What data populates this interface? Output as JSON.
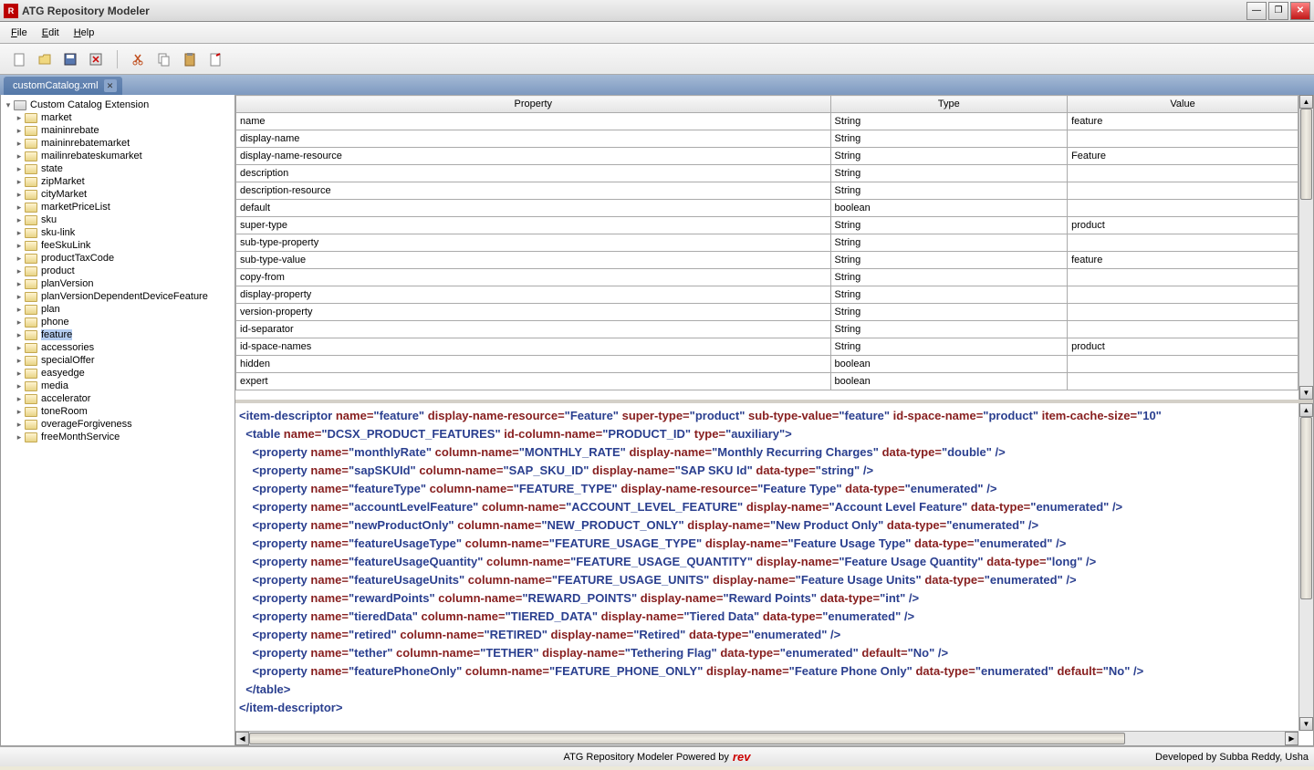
{
  "title": "ATG Repository Modeler",
  "menu": {
    "file": "File",
    "edit": "Edit",
    "help": "Help"
  },
  "tab": {
    "name": "customCatalog.xml"
  },
  "tree": {
    "root": "Custom Catalog Extension",
    "items": [
      "market",
      "maininrebate",
      "maininrebatemarket",
      "mailinrebateskumarket",
      "state",
      "zipMarket",
      "cityMarket",
      "marketPriceList",
      "sku",
      "sku-link",
      "feeSkuLink",
      "productTaxCode",
      "product",
      "planVersion",
      "planVersionDependentDeviceFeature",
      "plan",
      "phone",
      "feature",
      "accessories",
      "specialOffer",
      "easyedge",
      "media",
      "accelerator",
      "toneRoom",
      "overageForgiveness",
      "freeMonthService"
    ],
    "selected": "feature"
  },
  "table": {
    "headers": [
      "Property",
      "Type",
      "Value"
    ],
    "rows": [
      {
        "p": "name",
        "t": "String",
        "v": "feature"
      },
      {
        "p": "display-name",
        "t": "String",
        "v": ""
      },
      {
        "p": "display-name-resource",
        "t": "String",
        "v": "Feature"
      },
      {
        "p": "description",
        "t": "String",
        "v": ""
      },
      {
        "p": "description-resource",
        "t": "String",
        "v": ""
      },
      {
        "p": "default",
        "t": "boolean",
        "v": ""
      },
      {
        "p": "super-type",
        "t": "String",
        "v": "product"
      },
      {
        "p": "sub-type-property",
        "t": "String",
        "v": ""
      },
      {
        "p": "sub-type-value",
        "t": "String",
        "v": "feature"
      },
      {
        "p": "copy-from",
        "t": "String",
        "v": ""
      },
      {
        "p": "display-property",
        "t": "String",
        "v": ""
      },
      {
        "p": "version-property",
        "t": "String",
        "v": ""
      },
      {
        "p": "id-separator",
        "t": "String",
        "v": ""
      },
      {
        "p": "id-space-names",
        "t": "String",
        "v": "product"
      },
      {
        "p": "hidden",
        "t": "boolean",
        "v": ""
      },
      {
        "p": "expert",
        "t": "boolean",
        "v": ""
      }
    ]
  },
  "xml": {
    "itemDescriptor": {
      "name": "feature",
      "displayNameResource": "Feature",
      "superType": "product",
      "subTypeValue": "feature",
      "idSpaceName": "product",
      "itemCacheSize": "10"
    },
    "tableEl": {
      "name": "DCSX_PRODUCT_FEATURES",
      "idColumnName": "PRODUCT_ID",
      "type": "auxiliary"
    },
    "props": [
      {
        "name": "monthlyRate",
        "columnName": "MONTHLY_RATE",
        "displayName": "Monthly Recurring Charges",
        "dataType": "double"
      },
      {
        "name": "sapSKUId",
        "columnName": "SAP_SKU_ID",
        "displayName": "SAP SKU Id",
        "dataType": "string"
      },
      {
        "name": "featureType",
        "columnName": "FEATURE_TYPE",
        "displayNameResource": "Feature Type",
        "dataType": "enumerated"
      },
      {
        "name": "accountLevelFeature",
        "columnName": "ACCOUNT_LEVEL_FEATURE",
        "displayName": "Account Level Feature",
        "dataType": "enumerated"
      },
      {
        "name": "newProductOnly",
        "columnName": "NEW_PRODUCT_ONLY",
        "displayName": "New Product Only",
        "dataType": "enumerated"
      },
      {
        "name": "featureUsageType",
        "columnName": "FEATURE_USAGE_TYPE",
        "displayName": "Feature Usage Type",
        "dataType": "enumerated"
      },
      {
        "name": "featureUsageQuantity",
        "columnName": "FEATURE_USAGE_QUANTITY",
        "displayName": "Feature Usage Quantity",
        "dataType": "long"
      },
      {
        "name": "featureUsageUnits",
        "columnName": "FEATURE_USAGE_UNITS",
        "displayName": "Feature Usage Units",
        "dataType": "enumerated"
      },
      {
        "name": "rewardPoints",
        "columnName": "REWARD_POINTS",
        "displayName": "Reward Points",
        "dataType": "int"
      },
      {
        "name": "tieredData",
        "columnName": "TIERED_DATA",
        "displayName": "Tiered Data",
        "dataType": "enumerated"
      },
      {
        "name": "retired",
        "columnName": "RETIRED",
        "displayName": "Retired",
        "dataType": "enumerated"
      },
      {
        "name": "tether",
        "columnName": "TETHER",
        "displayName": "Tethering Flag",
        "dataType": "enumerated",
        "default": "No"
      },
      {
        "name": "featurePhoneOnly",
        "columnName": "FEATURE_PHONE_ONLY",
        "displayName": "Feature Phone Only",
        "dataType": "enumerated",
        "default": "No"
      }
    ]
  },
  "status": {
    "center": "ATG Repository Modeler Powered by",
    "logo": "rev",
    "right": "Developed by Subba Reddy, Usha"
  }
}
